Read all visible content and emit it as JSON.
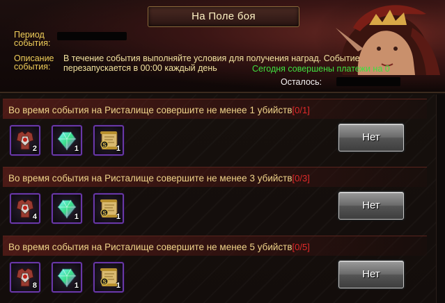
{
  "header": {
    "title": "На Поле боя",
    "period_label": "Период события:",
    "description_label": "Описание события:",
    "description_text_1": "В течение события выполняйте условия для получения наград. Событие",
    "description_text_2": "перезапускается в 00:00 каждый день",
    "payments_text": "Сегодня совершены платежи на 0",
    "remaining_label": "Осталось:"
  },
  "tasks": [
    {
      "text": "Во время события на Ристалище совершите не менее 1 убийств",
      "progress": "[0/1]",
      "button": "Нет",
      "rewards": [
        {
          "icon": "armor-chest-icon",
          "qty": "2"
        },
        {
          "icon": "gem-crystal-icon",
          "qty": "1"
        },
        {
          "icon": "scroll-icon",
          "qty": "1"
        }
      ]
    },
    {
      "text": "Во время события на Ристалище совершите не менее 3 убийств",
      "progress": "[0/3]",
      "button": "Нет",
      "rewards": [
        {
          "icon": "armor-chest-icon",
          "qty": "4"
        },
        {
          "icon": "gem-crystal-icon",
          "qty": "1"
        },
        {
          "icon": "scroll-icon",
          "qty": "1"
        }
      ]
    },
    {
      "text": "Во время события на Ристалище совершите не менее 5 убийств",
      "progress": "[0/5]",
      "button": "Нет",
      "rewards": [
        {
          "icon": "armor-chest-icon",
          "qty": "8"
        },
        {
          "icon": "gem-crystal-icon",
          "qty": "1"
        },
        {
          "icon": "scroll-icon",
          "qty": "1"
        }
      ]
    }
  ]
}
